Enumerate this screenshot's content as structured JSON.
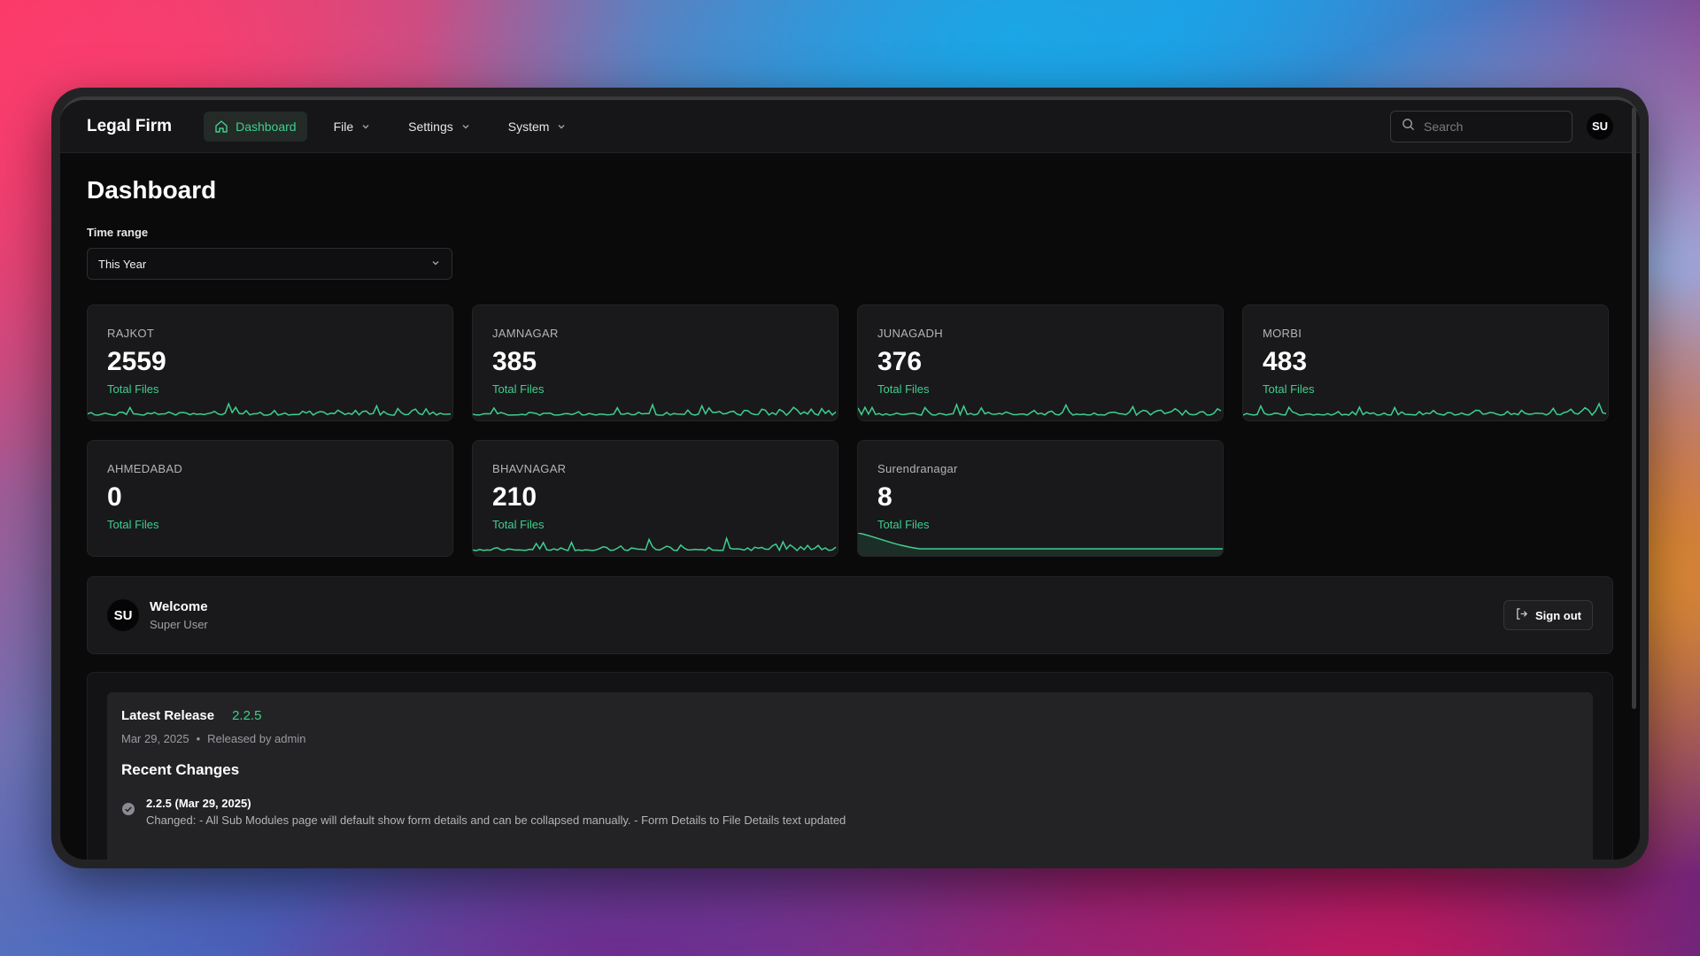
{
  "app": {
    "brand": "Legal Firm"
  },
  "nav": [
    {
      "label": "Dashboard",
      "icon": "home-icon",
      "active": true
    },
    {
      "label": "File",
      "icon": "chevron-down-icon",
      "active": false
    },
    {
      "label": "Settings",
      "icon": "chevron-down-icon",
      "active": false
    },
    {
      "label": "System",
      "icon": "chevron-down-icon",
      "active": false
    }
  ],
  "search": {
    "placeholder": "Search"
  },
  "user": {
    "initials": "SU"
  },
  "page": {
    "title": "Dashboard"
  },
  "time_range": {
    "label": "Time range",
    "value": "This Year"
  },
  "cards": [
    {
      "name": "RAJKOT",
      "value": "2559",
      "sub": "Total Files"
    },
    {
      "name": "JAMNAGAR",
      "value": "385",
      "sub": "Total Files"
    },
    {
      "name": "JUNAGADH",
      "value": "376",
      "sub": "Total Files"
    },
    {
      "name": "MORBI",
      "value": "483",
      "sub": "Total Files"
    },
    {
      "name": "AHMEDABAD",
      "value": "0",
      "sub": "Total Files"
    },
    {
      "name": "BHAVNAGAR",
      "value": "210",
      "sub": "Total Files"
    },
    {
      "name": "Surendranagar",
      "value": "8",
      "sub": "Total Files"
    }
  ],
  "welcome": {
    "initials": "SU",
    "title": "Welcome",
    "subtitle": "Super User",
    "signout_label": "Sign out"
  },
  "release": {
    "title": "Latest Release",
    "version": "2.2.5",
    "date": "Mar 29, 2025",
    "released_by": "Released by admin",
    "changes_title": "Recent Changes",
    "changes": [
      {
        "title": "2.2.5 (Mar 29, 2025)",
        "text": "Changed: - All Sub Modules page will default show form details and can be collapsed manually. - Form Details to File Details text updated"
      }
    ]
  },
  "colors": {
    "accent": "#3ecf8e",
    "background": "#0a0a0b",
    "card": "#19191b"
  }
}
